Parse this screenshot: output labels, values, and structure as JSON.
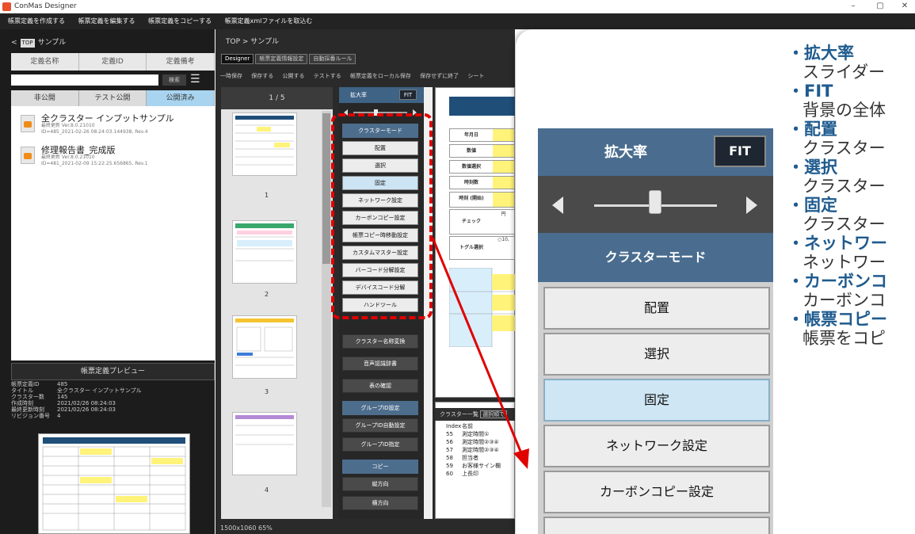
{
  "app": {
    "title": "ConMas Designer"
  },
  "menu": [
    "帳票定義を作成する",
    "帳票定義を編集する",
    "帳票定義をコピーする",
    "帳票定義xmlファイルを取込む"
  ],
  "left": {
    "top_label": "TOP",
    "folder": "サンプル",
    "columns": [
      "定義名称",
      "定義ID",
      "定義備考"
    ],
    "search_button": "検索",
    "tabs": [
      "非公開",
      "テスト公開",
      "公開済み"
    ],
    "items": [
      {
        "title": "全クラスター インプットサンプル",
        "line1": "最終更新 Ver.8.0.21010",
        "line2": "ID=485_2021-02-26 08:24:03.144938, Rev.4"
      },
      {
        "title": "修理報告書_完成版",
        "line1": "最終更新 Ver.8.0.21010",
        "line2": "ID=481_2021-02-09 15:22:25.656865, Rev.1"
      }
    ],
    "preview_title": "帳票定義プレビュー",
    "preview_info": [
      {
        "k": "帳票定義ID",
        "v": "485"
      },
      {
        "k": "タイトル",
        "v": "全クラスター インプットサンプル"
      },
      {
        "k": "クラスター数",
        "v": "145"
      },
      {
        "k": "作成時刻",
        "v": "2021/02/26 08:24:03"
      },
      {
        "k": "最終更新時刻",
        "v": "2021/02/26 08:24:03"
      },
      {
        "k": "リビジョン番号",
        "v": "4"
      }
    ]
  },
  "center": {
    "breadcrumb": "TOP > サンプル",
    "tabs": [
      "Designer",
      "帳票定義情報設定",
      "自動採番ルール"
    ],
    "toolbar": [
      "一時保存",
      "保存する",
      "公開する",
      "テストする",
      "帳票定義をローカル保存",
      "保存せずに終了",
      "シート"
    ],
    "page_indicator": "1 / 5",
    "page_numbers": [
      "1",
      "2",
      "3",
      "4"
    ],
    "status": "1500x1060 65%",
    "zoom_label": "拡大率",
    "fit_label": "FIT",
    "commands": [
      "クラスターモード",
      "配置",
      "選択",
      "固定",
      "ネットワーク設定",
      "カーボンコピー設定",
      "帳票コピー時移動設定",
      "カスタムマスター設定",
      "バーコード分解設定",
      "デバイスコード分解",
      "ハンドツール"
    ],
    "commands2": [
      "クラスター名称変換",
      "音声認識辞書",
      "表の確認"
    ],
    "group_header": "グループID設定",
    "group_cmds": [
      "グループID自動設定",
      "グループID指定"
    ],
    "copy_header": "コピー",
    "copy_cmds": [
      "縦方向",
      "横方向"
    ],
    "form_labels": [
      "年月日",
      "数値",
      "数値選択",
      "時刻数",
      "時刻\n(開始)",
      "チェック",
      "トグル選択"
    ],
    "form_extras": [
      "円",
      "○10,"
    ],
    "cluster_list": {
      "title": "クラスター一覧",
      "filter": "選択順で",
      "headers": [
        "Index",
        "名前"
      ],
      "rows": [
        {
          "i": "55",
          "n": "測定時間①"
        },
        {
          "i": "56",
          "n": "測定時間②③④"
        },
        {
          "i": "57",
          "n": "測定時間②③④"
        },
        {
          "i": "58",
          "n": "担当者"
        },
        {
          "i": "59",
          "n": "お客様サイン欄"
        },
        {
          "i": "60",
          "n": "上長印"
        }
      ]
    }
  },
  "zoom_panel": {
    "zoom_label": "拡大率",
    "fit_label": "FIT",
    "mode_label": "クラスターモード",
    "buttons": [
      "配置",
      "選択",
      "固定",
      "ネットワーク設定",
      "カーボンコピー設定"
    ]
  },
  "bullets": [
    {
      "term": "拡大率",
      "desc": "スライダー"
    },
    {
      "term": "FIT",
      "desc": "背景の全体"
    },
    {
      "term": "配置",
      "desc": "クラスター"
    },
    {
      "term": "選択",
      "desc": "クラスター"
    },
    {
      "term": "固定",
      "desc": "クラスター"
    },
    {
      "term": "ネットワー",
      "desc": "ネットワー"
    },
    {
      "term": "カーボンコ",
      "desc": "カーボンコ"
    },
    {
      "term": "帳票コピー",
      "desc": "帳票をコピ"
    }
  ],
  "colors": {
    "accent": "#4a6d8f",
    "highlight": "#e00000",
    "bullet": "#1f5b8f",
    "selected": "#cfe6f4"
  }
}
